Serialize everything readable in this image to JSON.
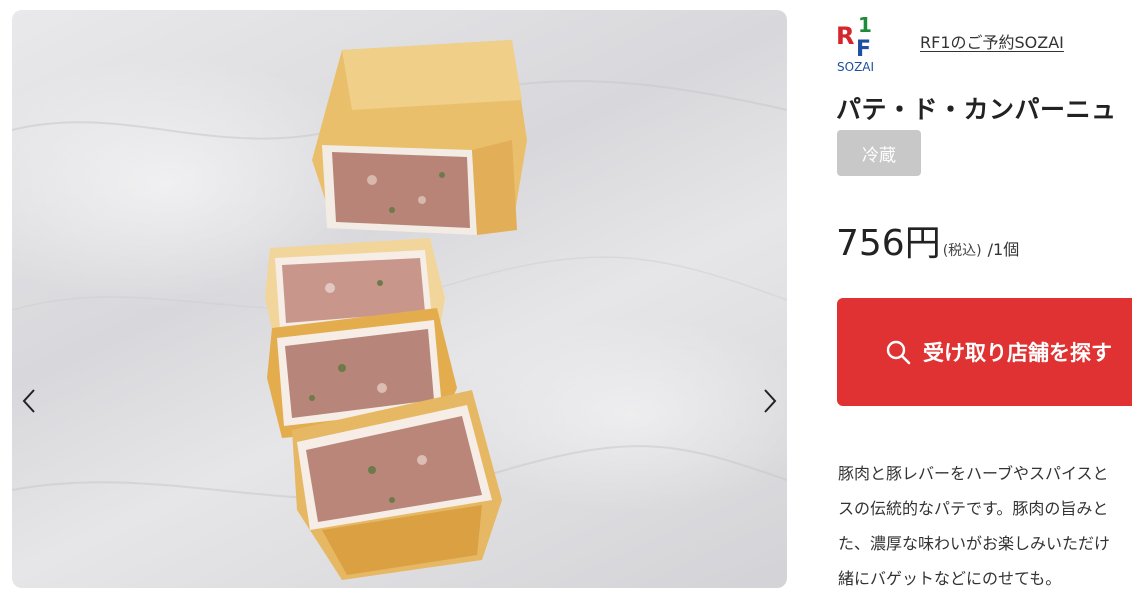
{
  "gallery": {
    "image_alt": "パテ・ド・カンパーニュ",
    "prev_icon": "chevron-left-icon",
    "next_icon": "chevron-right-icon"
  },
  "brand": {
    "logo_letters": "RF1",
    "logo_sub": "SOZAI",
    "link_text": "RF1のご予約SOZAI"
  },
  "product": {
    "title": "パテ・ド・カンパーニュ",
    "storage_badge": "冷蔵",
    "price": "756円",
    "tax_note": "(税込)",
    "unit": "/1個"
  },
  "action": {
    "search_icon": "search-icon",
    "search_label": "受け取り店舗を探す"
  },
  "description": {
    "lines": [
      "豚肉と豚レバーをハーブやスパイスと",
      "スの伝統的なパテです。豚肉の旨みと",
      "た、濃厚な味わいがお楽しみいただけ",
      "緒にバゲットなどにのせても。"
    ]
  },
  "colors": {
    "accent_red": "#e03232",
    "badge_gray": "#c8c8c8",
    "logo_red": "#d4262c",
    "logo_green": "#1f8a3a",
    "logo_blue": "#1f4fa0"
  }
}
